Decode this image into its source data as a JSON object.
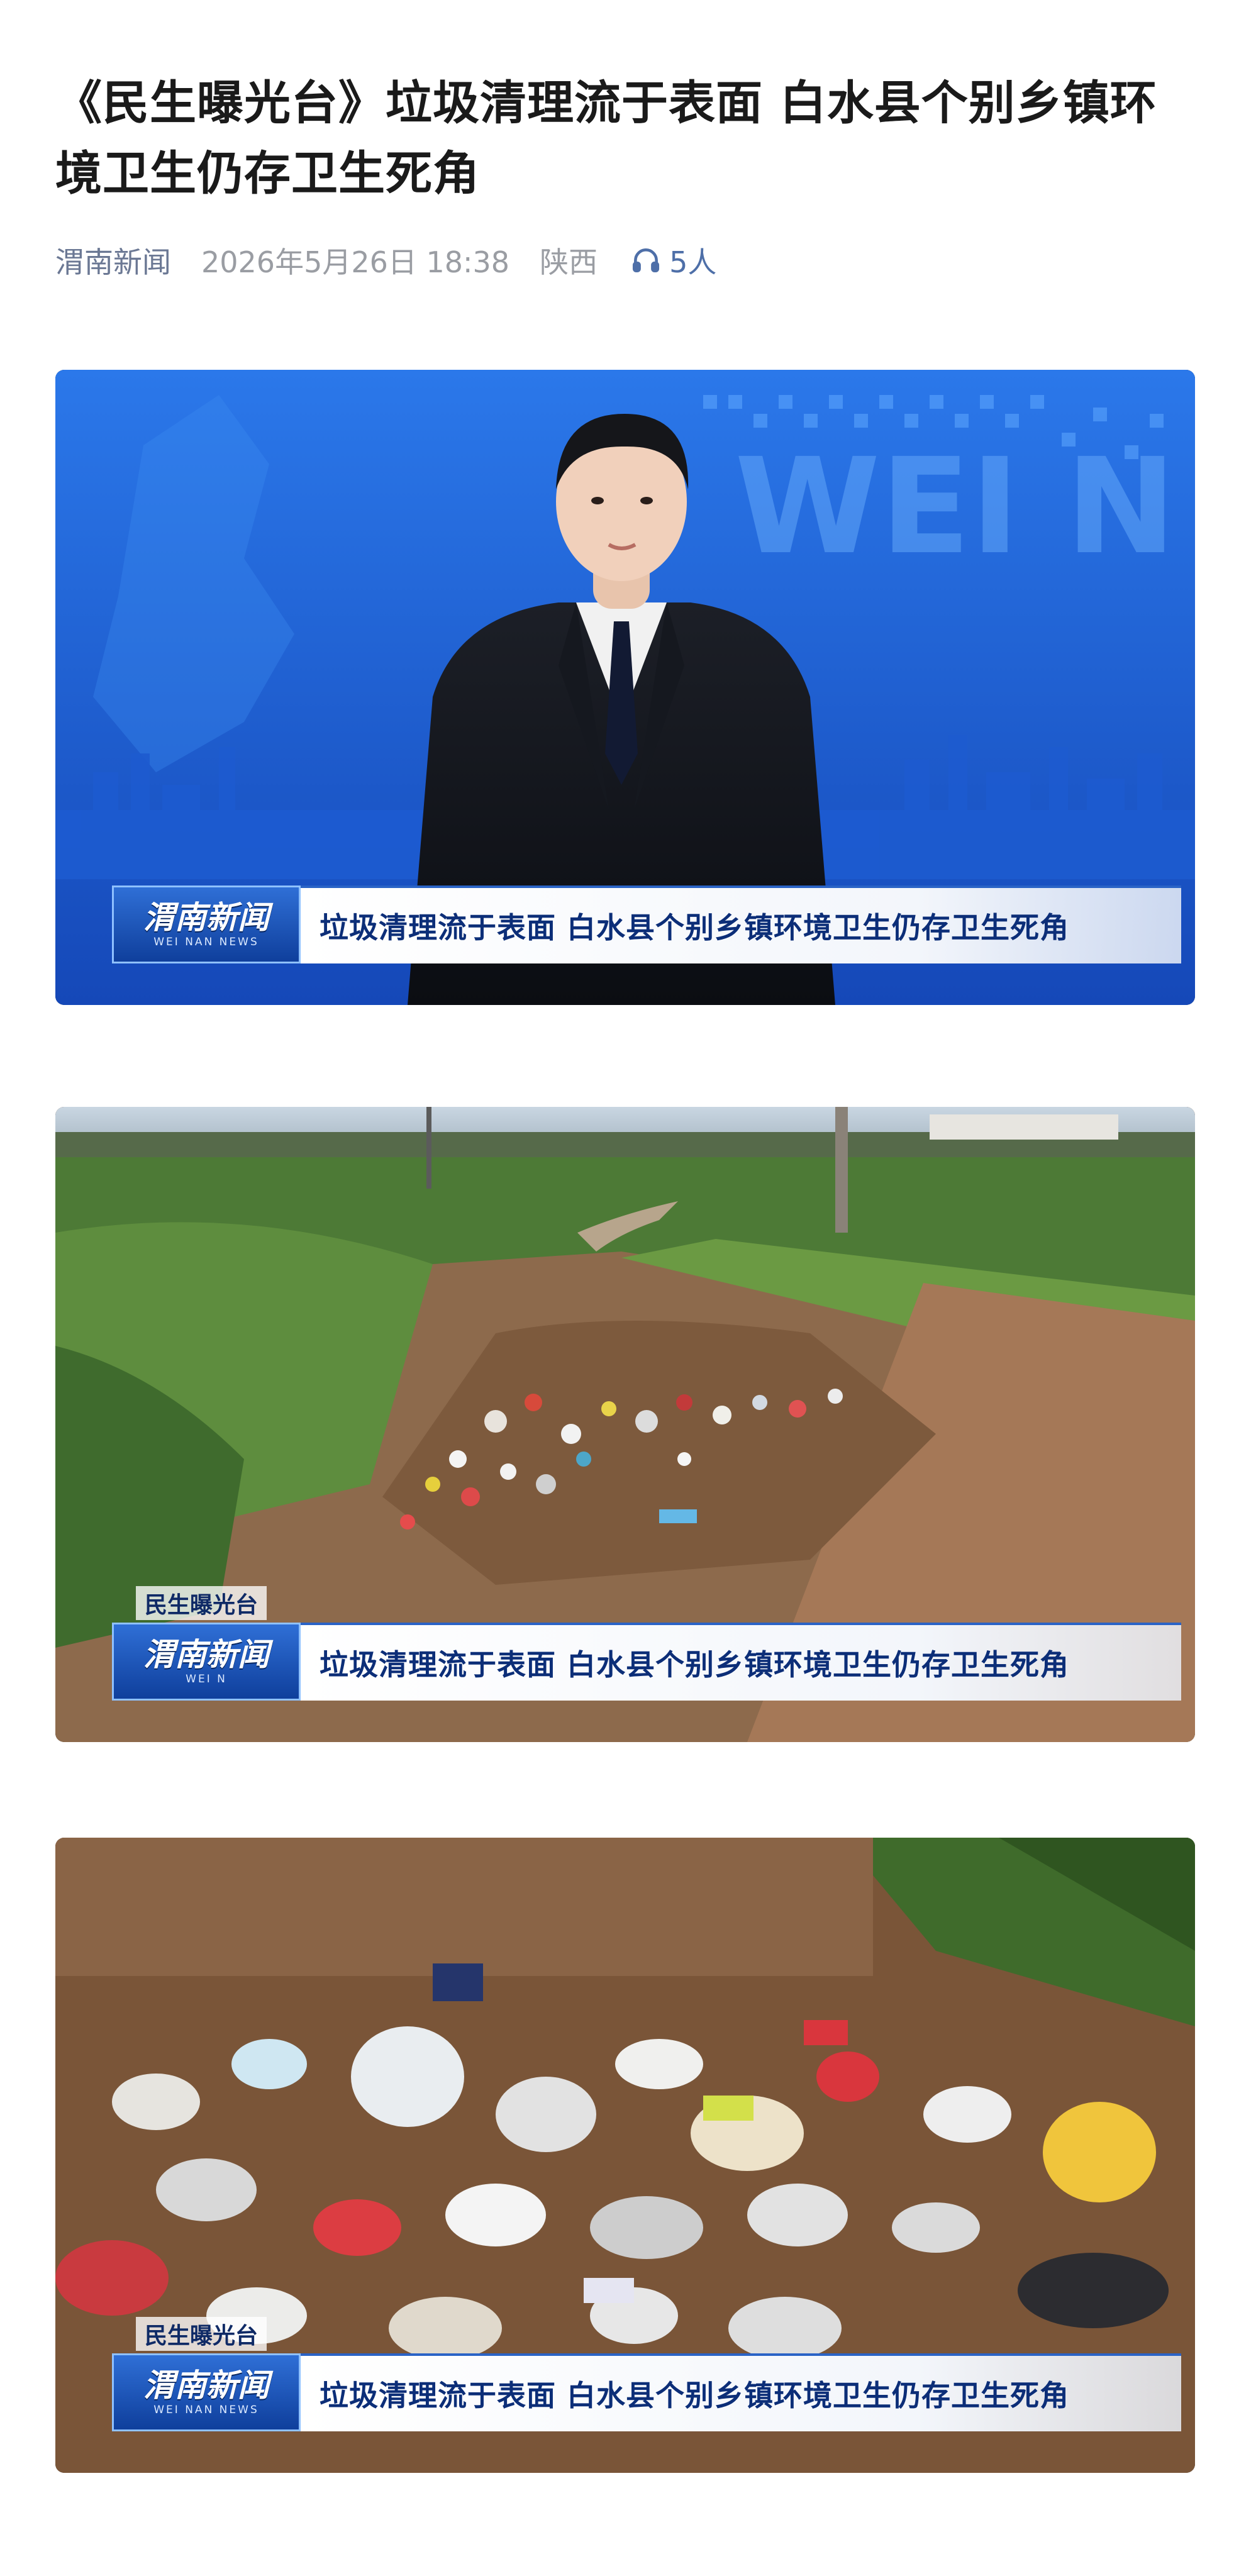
{
  "article": {
    "title": "《民生曝光台》垃圾清理流于表面 白水县个别乡镇环境卫生仍存卫生死角",
    "source": "渭南新闻",
    "datetime": "2026年5月26日 18:38",
    "region": "陕西",
    "listeners": "5人"
  },
  "frames": [
    {
      "logo_cn": "渭南新闻",
      "logo_en": "WEI NAN NEWS",
      "caption": "垃圾清理流于表面 白水县个别乡镇环境卫生仍存卫生死角",
      "backdrop_text": "WEI N"
    },
    {
      "tag": "民生曝光台",
      "logo_cn": "渭南新闻",
      "logo_en": "WEI N",
      "caption": "垃圾清理流于表面 白水县个别乡镇环境卫生仍存卫生死角"
    },
    {
      "tag": "民生曝光台",
      "logo_cn": "渭南新闻",
      "logo_en": "WEI NAN NEWS",
      "caption": "垃圾清理流于表面 白水县个别乡镇环境卫生仍存卫生死角"
    }
  ],
  "icons": {
    "listen": "headphones-icon"
  },
  "colors": {
    "source": "#6b7894",
    "meta": "#9a9da3",
    "listen": "#4e6fa8",
    "studio_blue": "#1f63d8",
    "caption": "#0c2e78"
  }
}
